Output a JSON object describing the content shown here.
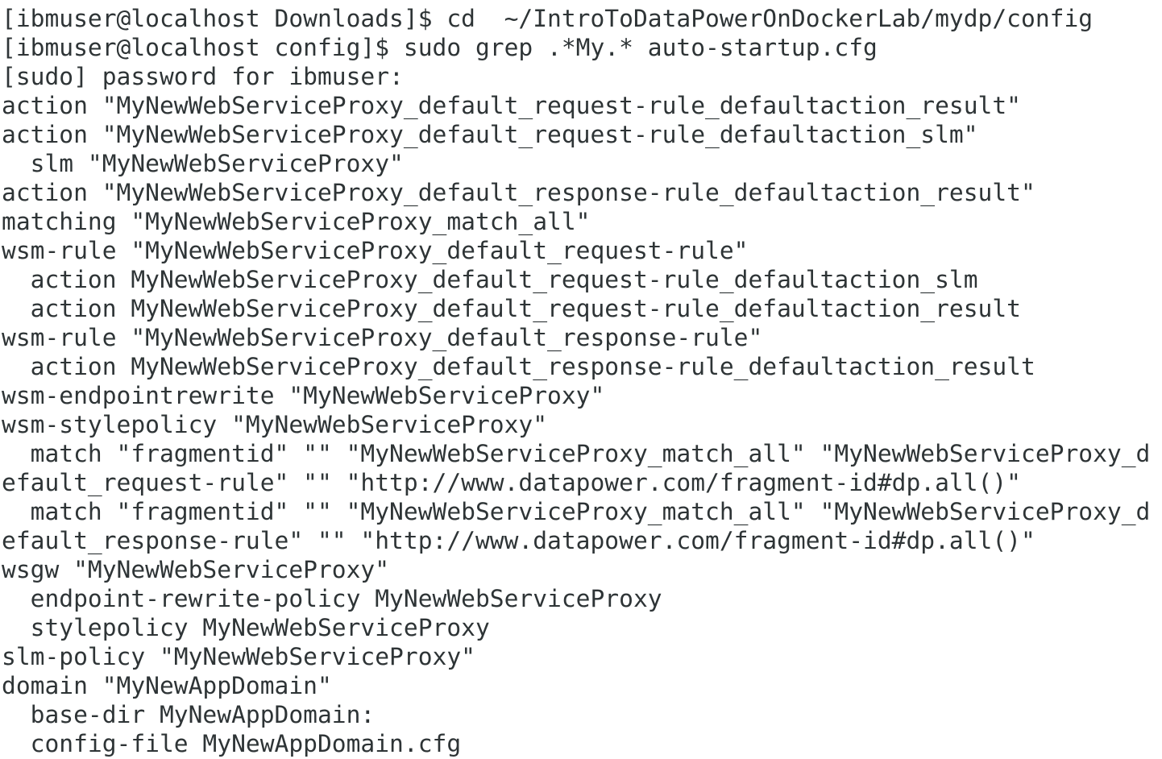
{
  "terminal": {
    "background": "#ffffff",
    "foreground": "#2e3436",
    "lines": [
      "[ibmuser@localhost Downloads]$ cd  ~/IntroToDataPowerOnDockerLab/mydp/config",
      "[ibmuser@localhost config]$ sudo grep .*My.* auto-startup.cfg",
      "[sudo] password for ibmuser:",
      "action \"MyNewWebServiceProxy_default_request-rule_defaultaction_result\"",
      "action \"MyNewWebServiceProxy_default_request-rule_defaultaction_slm\"",
      "  slm \"MyNewWebServiceProxy\"",
      "action \"MyNewWebServiceProxy_default_response-rule_defaultaction_result\"",
      "matching \"MyNewWebServiceProxy_match_all\"",
      "wsm-rule \"MyNewWebServiceProxy_default_request-rule\"",
      "  action MyNewWebServiceProxy_default_request-rule_defaultaction_slm",
      "  action MyNewWebServiceProxy_default_request-rule_defaultaction_result",
      "wsm-rule \"MyNewWebServiceProxy_default_response-rule\"",
      "  action MyNewWebServiceProxy_default_response-rule_defaultaction_result",
      "wsm-endpointrewrite \"MyNewWebServiceProxy\"",
      "wsm-stylepolicy \"MyNewWebServiceProxy\"",
      "  match \"fragmentid\" \"\" \"MyNewWebServiceProxy_match_all\" \"MyNewWebServiceProxy_d",
      "efault_request-rule\" \"\" \"http://www.datapower.com/fragment-id#dp.all()\"",
      "  match \"fragmentid\" \"\" \"MyNewWebServiceProxy_match_all\" \"MyNewWebServiceProxy_d",
      "efault_response-rule\" \"\" \"http://www.datapower.com/fragment-id#dp.all()\"",
      "wsgw \"MyNewWebServiceProxy\"",
      "  endpoint-rewrite-policy MyNewWebServiceProxy",
      "  stylepolicy MyNewWebServiceProxy",
      "slm-policy \"MyNewWebServiceProxy\"",
      "domain \"MyNewAppDomain\"",
      "  base-dir MyNewAppDomain:",
      "  config-file MyNewAppDomain.cfg"
    ]
  }
}
